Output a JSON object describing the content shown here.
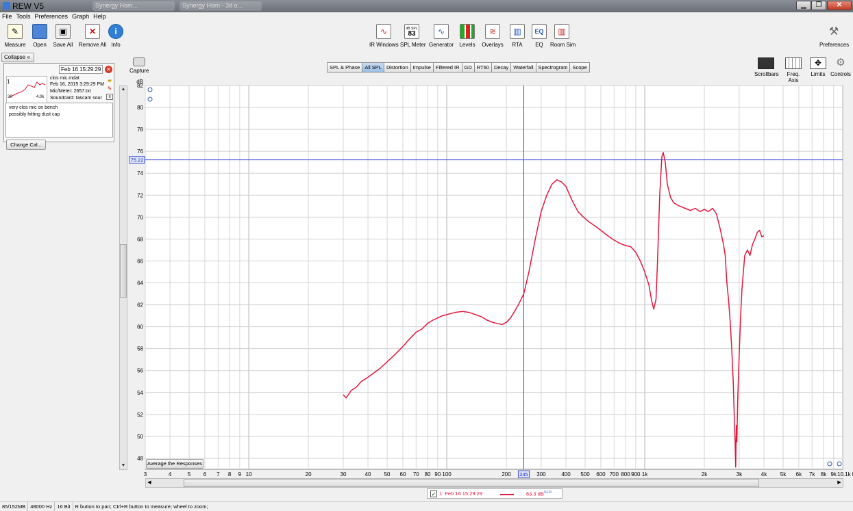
{
  "window": {
    "title": "REW V5",
    "bg_tabs": [
      "Synergy Hom...",
      "Synergy Horn - 3d o..."
    ]
  },
  "menu": [
    "File",
    "Tools",
    "Preferences",
    "Graph",
    "Help"
  ],
  "toolbar": {
    "measure": "Measure",
    "open": "Open",
    "save_all": "Save All",
    "remove_all": "Remove All",
    "info": "Info",
    "ir_windows": "IR Windows",
    "spl_meter": "SPL Meter",
    "spl_meter_icon_top": "dB SPL",
    "spl_meter_icon_value": "83",
    "generator": "Generator",
    "levels": "Levels",
    "overlays": "Overlays",
    "rta": "RTA",
    "eq": "EQ",
    "eq_icon": "EQ",
    "room_sim": "Room Sim",
    "preferences": "Preferences"
  },
  "left_panel": {
    "collapse": "Collapse",
    "measurement": {
      "date_field": "Feb 16 15:29:29",
      "number": "1",
      "name": "clos mic.mdat",
      "datetime": "Feb 16, 2015 3:29:29 PM",
      "mic_meter": "Mic/Meter: 2657.txt",
      "soundcard": "Soundcard: tascam sour",
      "thumb_lo": "30",
      "thumb_hi": "4.0k",
      "notes": [
        "very clos mic on bench",
        "possibly hitting dust cap"
      ]
    },
    "change_cal": "Change Cal..."
  },
  "capture": "Capture",
  "graph_tabs": [
    "SPL & Phase",
    "All SPL",
    "Distortion",
    "Impulse",
    "Filtered IR",
    "GD",
    "RT60",
    "Decay",
    "Waterfall",
    "Spectrogram",
    "Scope"
  ],
  "active_tab": "All SPL",
  "right_tools": {
    "scrollbars": "Scrollbars",
    "freq_axis": "Freq. Axis",
    "limits": "Limits",
    "controls": "Controls"
  },
  "average_button": "Average the Responses",
  "legend": {
    "checked": true,
    "name": "1: Feb 16 15:29:29",
    "value": "63.3 dB",
    "value_sup": "NEW",
    "color": "#e4163c"
  },
  "status": [
    "85/152MB",
    "48000 Hz",
    "16 Bit",
    "R button to pan; Ctrl+R button to measure; wheel to zoom;"
  ],
  "chart_data": {
    "type": "line",
    "x_scale": "log",
    "xlim": [
      3,
      10000
    ],
    "ylim": [
      47,
      82
    ],
    "ylabel": "dB",
    "y_ticks": [
      "48",
      "50",
      "52",
      "54",
      "56",
      "58",
      "60",
      "62",
      "64",
      "66",
      "68",
      "70",
      "72",
      "74",
      "76",
      "78",
      "80",
      "82"
    ],
    "x_ticks": [
      {
        "f": 3,
        "label": "3"
      },
      {
        "f": 4,
        "label": "4"
      },
      {
        "f": 5,
        "label": "5"
      },
      {
        "f": 6,
        "label": "6"
      },
      {
        "f": 7,
        "label": "7"
      },
      {
        "f": 8,
        "label": "8"
      },
      {
        "f": 9,
        "label": "9"
      },
      {
        "f": 10,
        "label": "10"
      },
      {
        "f": 20,
        "label": "20"
      },
      {
        "f": 30,
        "label": "30"
      },
      {
        "f": 40,
        "label": "40"
      },
      {
        "f": 50,
        "label": "50"
      },
      {
        "f": 60,
        "label": "60"
      },
      {
        "f": 70,
        "label": "70"
      },
      {
        "f": 80,
        "label": "80"
      },
      {
        "f": 90,
        "label": "90"
      },
      {
        "f": 100,
        "label": "100"
      },
      {
        "f": 200,
        "label": "200"
      },
      {
        "f": 300,
        "label": "300"
      },
      {
        "f": 400,
        "label": "400"
      },
      {
        "f": 500,
        "label": "500"
      },
      {
        "f": 600,
        "label": "600"
      },
      {
        "f": 700,
        "label": "700"
      },
      {
        "f": 800,
        "label": "800"
      },
      {
        "f": 900,
        "label": "900"
      },
      {
        "f": 1000,
        "label": "1k"
      },
      {
        "f": 2000,
        "label": "2k"
      },
      {
        "f": 3000,
        "label": "3k"
      },
      {
        "f": 4000,
        "label": "4k"
      },
      {
        "f": 5000,
        "label": "5k"
      },
      {
        "f": 6000,
        "label": "6k"
      },
      {
        "f": 7000,
        "label": "7k"
      },
      {
        "f": 8000,
        "label": "8k"
      },
      {
        "f": 9000,
        "label": "9k"
      },
      {
        "f": 10000,
        "label": "10.1k Hz"
      }
    ],
    "cursor": {
      "x": 245,
      "x_label": "245",
      "y": 75.22,
      "y_label": "75.22"
    },
    "series": [
      {
        "color": "#e4163c",
        "points": [
          [
            30,
            53.8
          ],
          [
            31,
            53.5
          ],
          [
            33,
            54.2
          ],
          [
            35,
            54.5
          ],
          [
            37,
            55.0
          ],
          [
            40,
            55.4
          ],
          [
            43,
            55.8
          ],
          [
            46,
            56.2
          ],
          [
            50,
            56.8
          ],
          [
            55,
            57.5
          ],
          [
            60,
            58.2
          ],
          [
            65,
            58.9
          ],
          [
            70,
            59.5
          ],
          [
            75,
            59.8
          ],
          [
            80,
            60.3
          ],
          [
            85,
            60.6
          ],
          [
            90,
            60.8
          ],
          [
            95,
            61.0
          ],
          [
            100,
            61.1
          ],
          [
            110,
            61.3
          ],
          [
            120,
            61.4
          ],
          [
            130,
            61.3
          ],
          [
            140,
            61.1
          ],
          [
            150,
            60.9
          ],
          [
            160,
            60.6
          ],
          [
            170,
            60.4
          ],
          [
            180,
            60.3
          ],
          [
            190,
            60.2
          ],
          [
            200,
            60.4
          ],
          [
            210,
            60.8
          ],
          [
            220,
            61.4
          ],
          [
            230,
            62.0
          ],
          [
            245,
            63.0
          ],
          [
            260,
            65.0
          ],
          [
            280,
            68.0
          ],
          [
            300,
            70.5
          ],
          [
            320,
            72.0
          ],
          [
            340,
            73.0
          ],
          [
            360,
            73.4
          ],
          [
            380,
            73.2
          ],
          [
            400,
            72.8
          ],
          [
            430,
            71.5
          ],
          [
            460,
            70.5
          ],
          [
            490,
            70.0
          ],
          [
            520,
            69.6
          ],
          [
            560,
            69.2
          ],
          [
            600,
            68.8
          ],
          [
            650,
            68.3
          ],
          [
            700,
            67.9
          ],
          [
            750,
            67.6
          ],
          [
            800,
            67.4
          ],
          [
            850,
            67.3
          ],
          [
            900,
            66.8
          ],
          [
            950,
            66.0
          ],
          [
            1000,
            65.0
          ],
          [
            1050,
            63.8
          ],
          [
            1080,
            62.5
          ],
          [
            1110,
            61.6
          ],
          [
            1140,
            62.5
          ],
          [
            1160,
            66.0
          ],
          [
            1190,
            72.0
          ],
          [
            1220,
            75.5
          ],
          [
            1240,
            75.9
          ],
          [
            1270,
            75.0
          ],
          [
            1300,
            73.0
          ],
          [
            1350,
            71.8
          ],
          [
            1400,
            71.3
          ],
          [
            1500,
            71.0
          ],
          [
            1600,
            70.8
          ],
          [
            1700,
            70.6
          ],
          [
            1800,
            70.8
          ],
          [
            1900,
            70.5
          ],
          [
            2000,
            70.7
          ],
          [
            2100,
            70.5
          ],
          [
            2200,
            70.8
          ],
          [
            2300,
            70.3
          ],
          [
            2400,
            69.0
          ],
          [
            2500,
            67.5
          ],
          [
            2550,
            66.5
          ],
          [
            2600,
            64.0
          ],
          [
            2650,
            62.5
          ],
          [
            2700,
            60.5
          ],
          [
            2750,
            58.0
          ],
          [
            2800,
            55.0
          ],
          [
            2830,
            52.0
          ],
          [
            2860,
            49.5
          ],
          [
            2880,
            47.2
          ],
          [
            2900,
            51.0
          ],
          [
            2920,
            49.5
          ],
          [
            2950,
            53.5
          ],
          [
            3000,
            57.5
          ],
          [
            3050,
            61.0
          ],
          [
            3100,
            63.5
          ],
          [
            3150,
            65.0
          ],
          [
            3200,
            66.5
          ],
          [
            3300,
            67.0
          ],
          [
            3400,
            66.5
          ],
          [
            3500,
            67.5
          ],
          [
            3600,
            68.0
          ],
          [
            3700,
            68.6
          ],
          [
            3800,
            68.8
          ],
          [
            3900,
            68.2
          ],
          [
            4000,
            68.3
          ]
        ]
      }
    ]
  }
}
